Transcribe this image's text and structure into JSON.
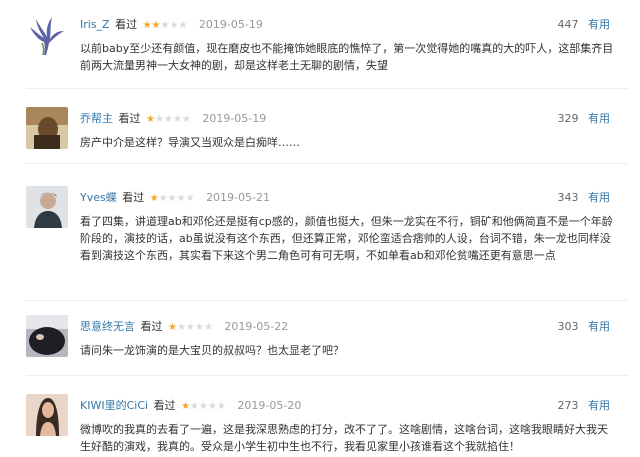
{
  "reviews": [
    {
      "user": "Iris_Z",
      "watched": "看过",
      "rating": 2,
      "date": "2019-05-19",
      "count": "447",
      "useful": "有用",
      "text": "以前baby至少还有颜值，现在磨皮也不能掩饰她眼底的憔悴了，第一次觉得她的嘴真的大的吓人，这部集齐目前两大流量男神一大女神的剧，却是这样老土无聊的剧情，失望",
      "avatar_colors": [
        "#5c63a8",
        "#cfd6e8"
      ]
    },
    {
      "user": "乔帮主",
      "watched": "看过",
      "rating": 1,
      "date": "2019-05-19",
      "count": "329",
      "useful": "有用",
      "text": "房产中介是这样？导演又当观众是白痴咩……",
      "avatar_colors": [
        "#8a6a3f",
        "#d9c8a4"
      ]
    },
    {
      "user": "Yves蝶",
      "watched": "看过",
      "rating": 1,
      "date": "2019-05-21",
      "count": "343",
      "useful": "有用",
      "text": "看了四集，讲道理ab和邓伦还是挺有cp感的，颜值也挺大，但朱一龙实在不行，铜矿和他俩简直不是一个年龄阶段的，演技的话，ab虽说没有这个东西，但还算正常，邓伦蛮适合痞帅的人设，台词不错，朱一龙也同样没看到演技这个东西，其实看下来这个男二角色可有可无啊，不如单看ab和邓伦贫嘴还更有意思一点",
      "avatar_colors": [
        "#2f3a44",
        "#dfe3e7"
      ]
    },
    {
      "user": "思意终无言",
      "watched": "看过",
      "rating": 1,
      "date": "2019-05-22",
      "count": "303",
      "useful": "有用",
      "text": "请问朱一龙饰演的是大宝贝的叔叔吗？也太显老了吧？",
      "avatar_colors": [
        "#1e1e24",
        "#b9b4bd"
      ]
    },
    {
      "user": "KIWI里的CiCi",
      "watched": "看过",
      "rating": 1,
      "date": "2019-05-20",
      "count": "273",
      "useful": "有用",
      "text": "微博吹的我真的去看了一遍，这是我深思熟虑的打分，改不了了。这啥剧情，这啥台词，这啥我眼睛好大我天生好酷的演戏，我真的。受众是小学生初中生也不行，我看见家里小孩谁看这个我就掐住！",
      "avatar_colors": [
        "#6b4a3a",
        "#e9d6c9"
      ]
    }
  ]
}
